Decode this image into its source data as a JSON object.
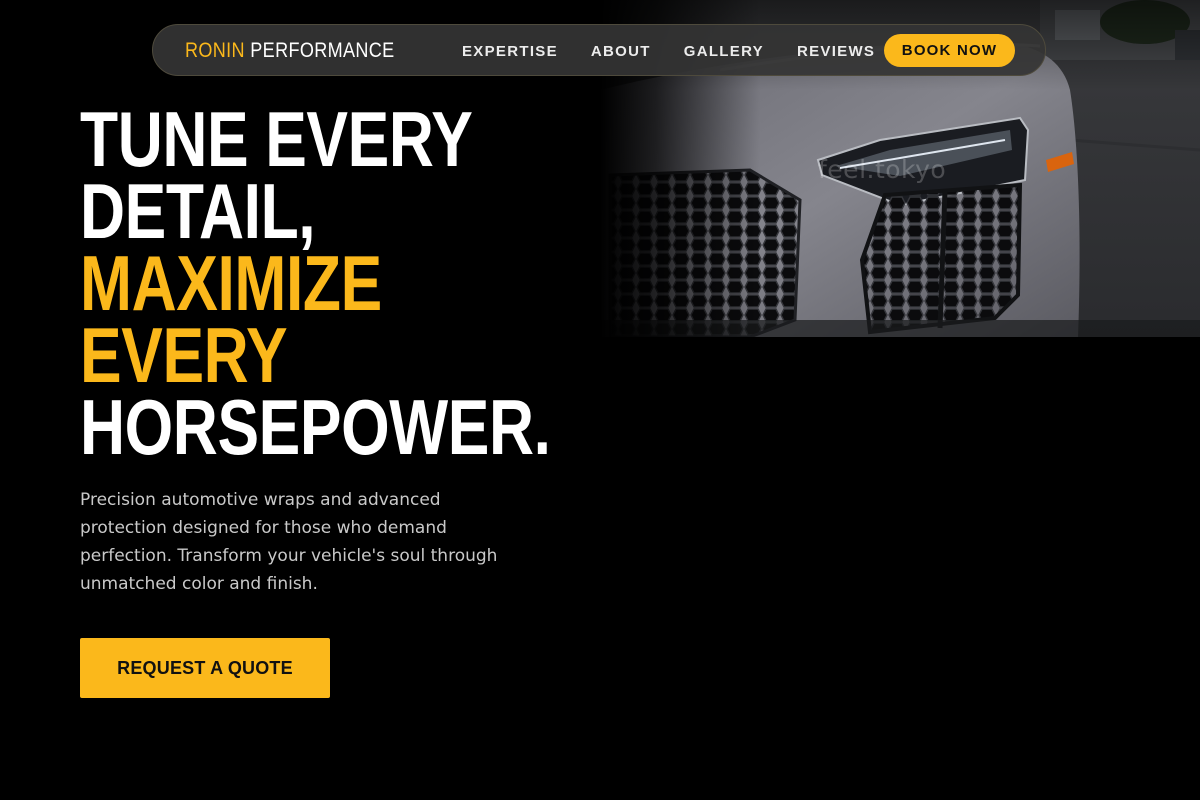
{
  "brand": {
    "part1": "RONIN",
    "part2": "PERFORMANCE"
  },
  "nav": {
    "links": [
      {
        "label": "EXPERTISE"
      },
      {
        "label": "ABOUT"
      },
      {
        "label": "GALLERY"
      },
      {
        "label": "REVIEWS"
      }
    ],
    "cta_label": "BOOK NOW"
  },
  "hero": {
    "headline": {
      "line1": "TUNE EVERY",
      "line2": "DETAIL,",
      "line3": "MAXIMIZE",
      "line4": "EVERY",
      "line5": "HORSEPOWER."
    },
    "description": "Precision automotive wraps and advanced protection designed for those who demand perfection. Transform your vehicle's soul through unmatched color and finish.",
    "cta_label": "REQUEST A QUOTE",
    "image": {
      "subject": "front-of-grey-sports-car",
      "watermark": "feel.tokyo"
    }
  },
  "colors": {
    "accent": "#fbb81b",
    "background": "#000000",
    "nav_bg": "#343434",
    "text_primary": "#ffffff",
    "text_secondary": "#c9c9c9"
  }
}
